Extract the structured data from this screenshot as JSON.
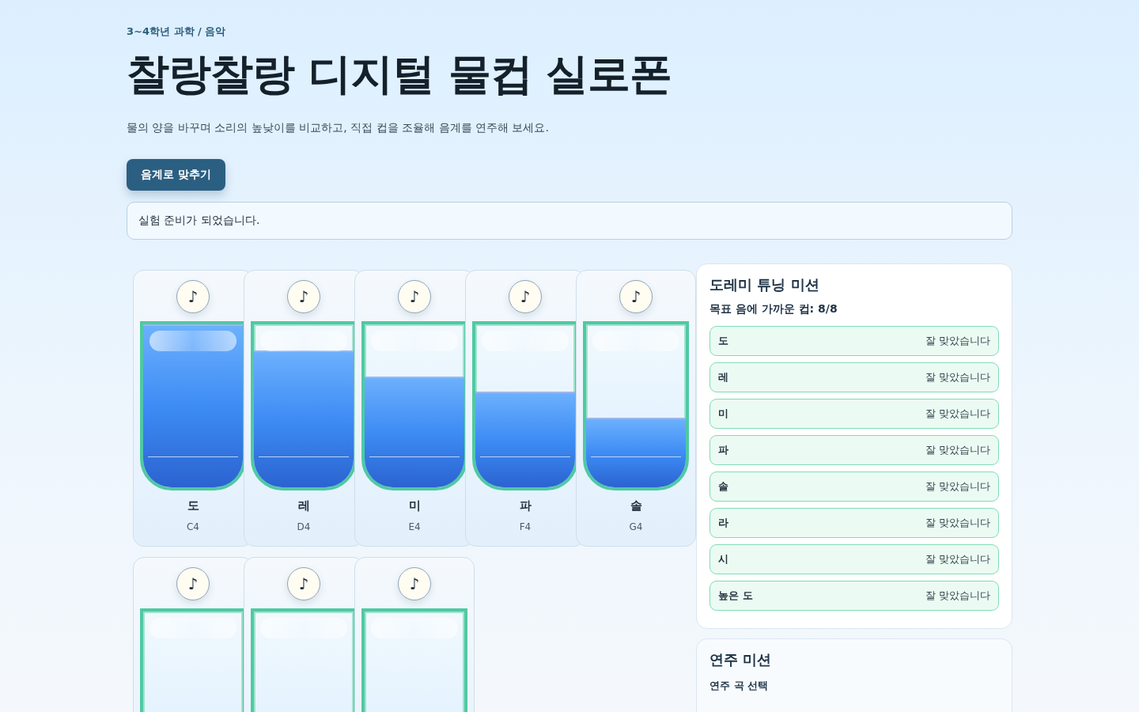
{
  "header": {
    "eyebrow": "3~4학년 과학 / 음악",
    "title": "찰랑찰랑 디지털 물컵 실로폰",
    "description": "물의 양을 바꾸며 소리의 높낮이를 비교하고, 직접 컵을 조율해 음계를 연주해 보세요.",
    "action_button": "음계로 맞추기"
  },
  "status_message": "실험 준비가 되었습니다.",
  "cups": [
    {
      "play_button": "♪",
      "level": 1.0,
      "note": "도",
      "pitch": "C4"
    },
    {
      "play_button": "♪",
      "level": 0.84,
      "note": "레",
      "pitch": "D4"
    },
    {
      "play_button": "♪",
      "level": 0.68,
      "note": "미",
      "pitch": "E4"
    },
    {
      "play_button": "♪",
      "level": 0.59,
      "note": "파",
      "pitch": "F4"
    },
    {
      "play_button": "♪",
      "level": 0.43,
      "note": "솔",
      "pitch": "G4"
    },
    {
      "play_button": "♪"
    },
    {
      "play_button": "♪"
    },
    {
      "play_button": "♪"
    }
  ],
  "tuning_panel": {
    "title": "도레미 튜닝 미션",
    "summary": "목표 음에 가까운 컵: 8/8",
    "rows": [
      {
        "note": "도",
        "status": "잘 맞았습니다",
        "matched": true
      },
      {
        "note": "레",
        "status": "잘 맞았습니다",
        "matched": true
      },
      {
        "note": "미",
        "status": "잘 맞았습니다",
        "matched": true
      },
      {
        "note": "파",
        "status": "잘 맞았습니다",
        "matched": true
      },
      {
        "note": "솔",
        "status": "잘 맞았습니다",
        "matched": true
      },
      {
        "note": "라",
        "status": "잘 맞았습니다",
        "matched": true
      },
      {
        "note": "시",
        "status": "잘 맞았습니다",
        "matched": true
      },
      {
        "note": "높은 도",
        "status": "잘 맞았습니다",
        "matched": true
      }
    ]
  },
  "play_panel": {
    "title": "연주 미션",
    "label": "연주 곡 선택"
  }
}
